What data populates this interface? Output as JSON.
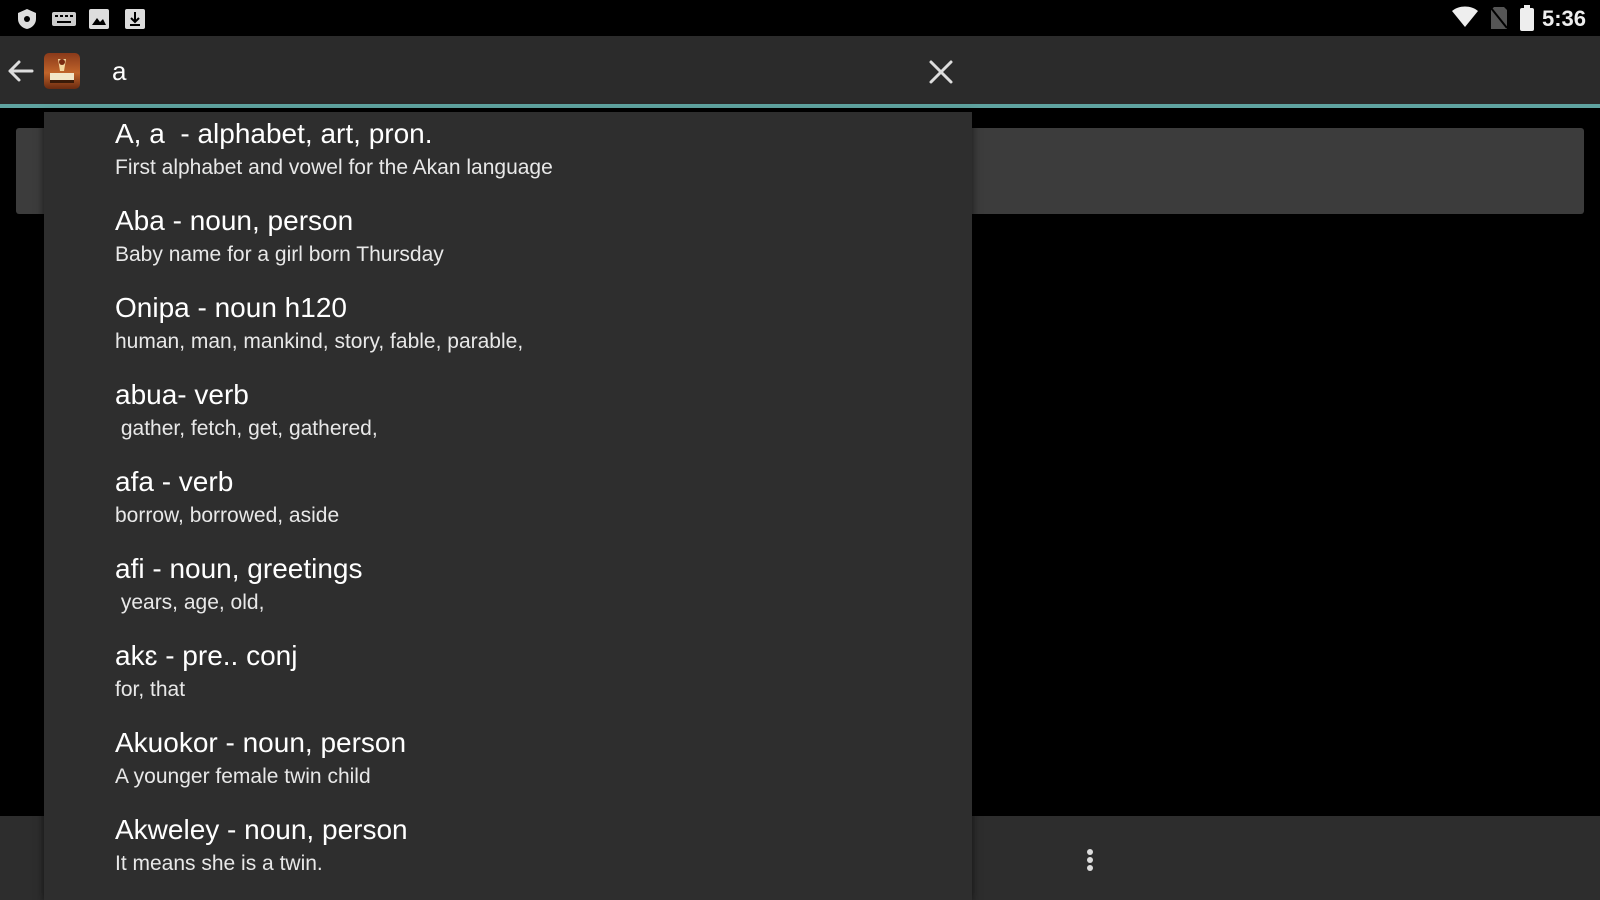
{
  "status_bar": {
    "time": "5:36",
    "left_icons": [
      "shield-icon",
      "keyboard-icon",
      "image-icon",
      "download-icon"
    ],
    "right_icons": [
      "wifi-icon",
      "no-sim-icon",
      "battery-icon"
    ]
  },
  "action_bar": {
    "search_value": "a",
    "accent_color": "#5fa3a0"
  },
  "suggestions": [
    {
      "title": "A, a  - alphabet, art, pron.",
      "desc": "First alphabet and vowel for the Akan language"
    },
    {
      "title": "Aba - noun, person",
      "desc": "Baby name for a girl born Thursday"
    },
    {
      "title": "Onipa - noun h120",
      "desc": "human, man, mankind, story, fable, parable,"
    },
    {
      "title": "abua- verb",
      "desc": " gather, fetch, get, gathered,"
    },
    {
      "title": "afa - verb",
      "desc": "borrow, borrowed, aside"
    },
    {
      "title": "afi - noun, greetings",
      "desc": " years, age, old,"
    },
    {
      "title": "akɛ - pre.. conj",
      "desc": "for, that"
    },
    {
      "title": "Akuokor - noun, person",
      "desc": "A younger female twin child"
    },
    {
      "title": "Akweley - noun, person",
      "desc": "It means she is a twin."
    }
  ]
}
